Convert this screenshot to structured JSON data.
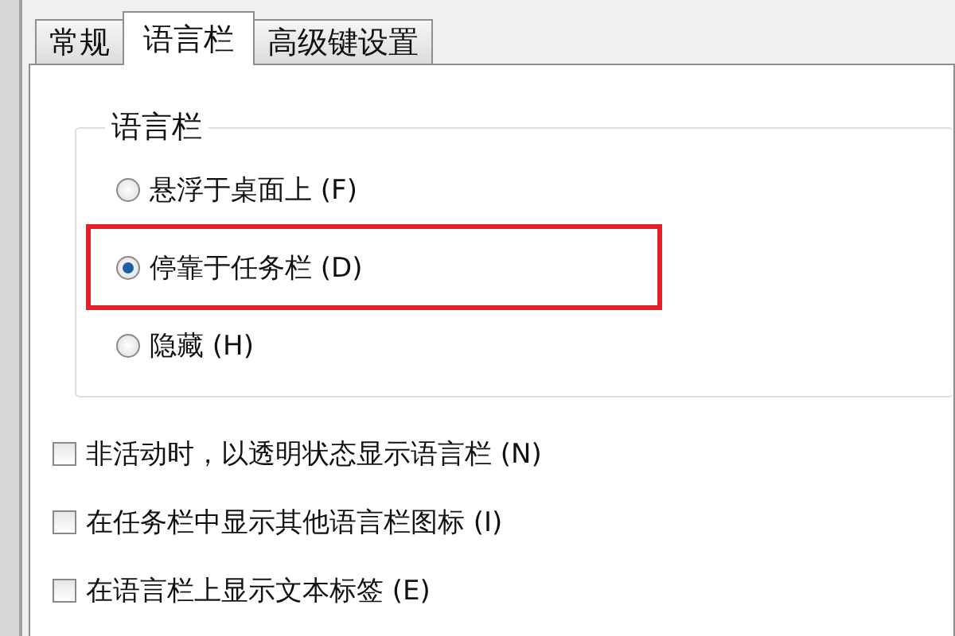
{
  "tabs": [
    {
      "label": "常规",
      "selected": false
    },
    {
      "label": "语言栏",
      "selected": true
    },
    {
      "label": "高级键设置",
      "selected": false
    }
  ],
  "group": {
    "title": "语言栏",
    "options": [
      {
        "label": "悬浮于桌面上 (F)",
        "selected": false,
        "highlighted": false
      },
      {
        "label": "停靠于任务栏 (D)",
        "selected": true,
        "highlighted": true
      },
      {
        "label": "隐藏 (H)",
        "selected": false,
        "highlighted": false
      }
    ]
  },
  "checkboxes": [
    {
      "label": "非活动时，以透明状态显示语言栏 (N)",
      "checked": false
    },
    {
      "label": "在任务栏中显示其他语言栏图标 (I)",
      "checked": false
    },
    {
      "label": "在语言栏上显示文本标签 (E)",
      "checked": false
    }
  ]
}
